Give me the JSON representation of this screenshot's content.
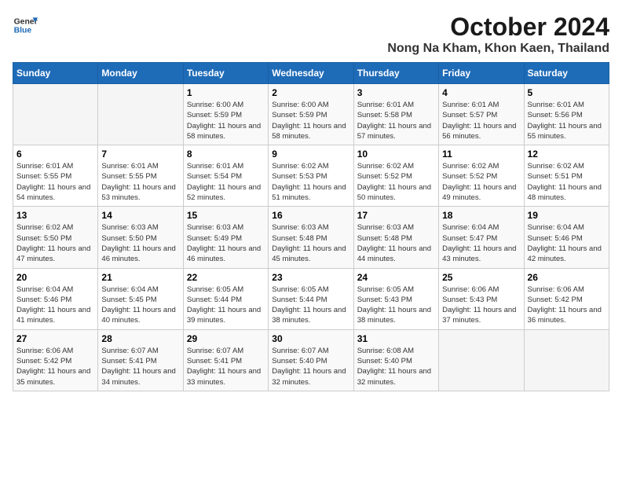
{
  "logo": {
    "line1": "General",
    "line2": "Blue"
  },
  "title": "October 2024",
  "location": "Nong Na Kham, Khon Kaen, Thailand",
  "days_of_week": [
    "Sunday",
    "Monday",
    "Tuesday",
    "Wednesday",
    "Thursday",
    "Friday",
    "Saturday"
  ],
  "weeks": [
    [
      {
        "day": "",
        "info": ""
      },
      {
        "day": "",
        "info": ""
      },
      {
        "day": "1",
        "info": "Sunrise: 6:00 AM\nSunset: 5:59 PM\nDaylight: 11 hours and 58 minutes."
      },
      {
        "day": "2",
        "info": "Sunrise: 6:00 AM\nSunset: 5:59 PM\nDaylight: 11 hours and 58 minutes."
      },
      {
        "day": "3",
        "info": "Sunrise: 6:01 AM\nSunset: 5:58 PM\nDaylight: 11 hours and 57 minutes."
      },
      {
        "day": "4",
        "info": "Sunrise: 6:01 AM\nSunset: 5:57 PM\nDaylight: 11 hours and 56 minutes."
      },
      {
        "day": "5",
        "info": "Sunrise: 6:01 AM\nSunset: 5:56 PM\nDaylight: 11 hours and 55 minutes."
      }
    ],
    [
      {
        "day": "6",
        "info": "Sunrise: 6:01 AM\nSunset: 5:55 PM\nDaylight: 11 hours and 54 minutes."
      },
      {
        "day": "7",
        "info": "Sunrise: 6:01 AM\nSunset: 5:55 PM\nDaylight: 11 hours and 53 minutes."
      },
      {
        "day": "8",
        "info": "Sunrise: 6:01 AM\nSunset: 5:54 PM\nDaylight: 11 hours and 52 minutes."
      },
      {
        "day": "9",
        "info": "Sunrise: 6:02 AM\nSunset: 5:53 PM\nDaylight: 11 hours and 51 minutes."
      },
      {
        "day": "10",
        "info": "Sunrise: 6:02 AM\nSunset: 5:52 PM\nDaylight: 11 hours and 50 minutes."
      },
      {
        "day": "11",
        "info": "Sunrise: 6:02 AM\nSunset: 5:52 PM\nDaylight: 11 hours and 49 minutes."
      },
      {
        "day": "12",
        "info": "Sunrise: 6:02 AM\nSunset: 5:51 PM\nDaylight: 11 hours and 48 minutes."
      }
    ],
    [
      {
        "day": "13",
        "info": "Sunrise: 6:02 AM\nSunset: 5:50 PM\nDaylight: 11 hours and 47 minutes."
      },
      {
        "day": "14",
        "info": "Sunrise: 6:03 AM\nSunset: 5:50 PM\nDaylight: 11 hours and 46 minutes."
      },
      {
        "day": "15",
        "info": "Sunrise: 6:03 AM\nSunset: 5:49 PM\nDaylight: 11 hours and 46 minutes."
      },
      {
        "day": "16",
        "info": "Sunrise: 6:03 AM\nSunset: 5:48 PM\nDaylight: 11 hours and 45 minutes."
      },
      {
        "day": "17",
        "info": "Sunrise: 6:03 AM\nSunset: 5:48 PM\nDaylight: 11 hours and 44 minutes."
      },
      {
        "day": "18",
        "info": "Sunrise: 6:04 AM\nSunset: 5:47 PM\nDaylight: 11 hours and 43 minutes."
      },
      {
        "day": "19",
        "info": "Sunrise: 6:04 AM\nSunset: 5:46 PM\nDaylight: 11 hours and 42 minutes."
      }
    ],
    [
      {
        "day": "20",
        "info": "Sunrise: 6:04 AM\nSunset: 5:46 PM\nDaylight: 11 hours and 41 minutes."
      },
      {
        "day": "21",
        "info": "Sunrise: 6:04 AM\nSunset: 5:45 PM\nDaylight: 11 hours and 40 minutes."
      },
      {
        "day": "22",
        "info": "Sunrise: 6:05 AM\nSunset: 5:44 PM\nDaylight: 11 hours and 39 minutes."
      },
      {
        "day": "23",
        "info": "Sunrise: 6:05 AM\nSunset: 5:44 PM\nDaylight: 11 hours and 38 minutes."
      },
      {
        "day": "24",
        "info": "Sunrise: 6:05 AM\nSunset: 5:43 PM\nDaylight: 11 hours and 38 minutes."
      },
      {
        "day": "25",
        "info": "Sunrise: 6:06 AM\nSunset: 5:43 PM\nDaylight: 11 hours and 37 minutes."
      },
      {
        "day": "26",
        "info": "Sunrise: 6:06 AM\nSunset: 5:42 PM\nDaylight: 11 hours and 36 minutes."
      }
    ],
    [
      {
        "day": "27",
        "info": "Sunrise: 6:06 AM\nSunset: 5:42 PM\nDaylight: 11 hours and 35 minutes."
      },
      {
        "day": "28",
        "info": "Sunrise: 6:07 AM\nSunset: 5:41 PM\nDaylight: 11 hours and 34 minutes."
      },
      {
        "day": "29",
        "info": "Sunrise: 6:07 AM\nSunset: 5:41 PM\nDaylight: 11 hours and 33 minutes."
      },
      {
        "day": "30",
        "info": "Sunrise: 6:07 AM\nSunset: 5:40 PM\nDaylight: 11 hours and 32 minutes."
      },
      {
        "day": "31",
        "info": "Sunrise: 6:08 AM\nSunset: 5:40 PM\nDaylight: 11 hours and 32 minutes."
      },
      {
        "day": "",
        "info": ""
      },
      {
        "day": "",
        "info": ""
      }
    ]
  ]
}
